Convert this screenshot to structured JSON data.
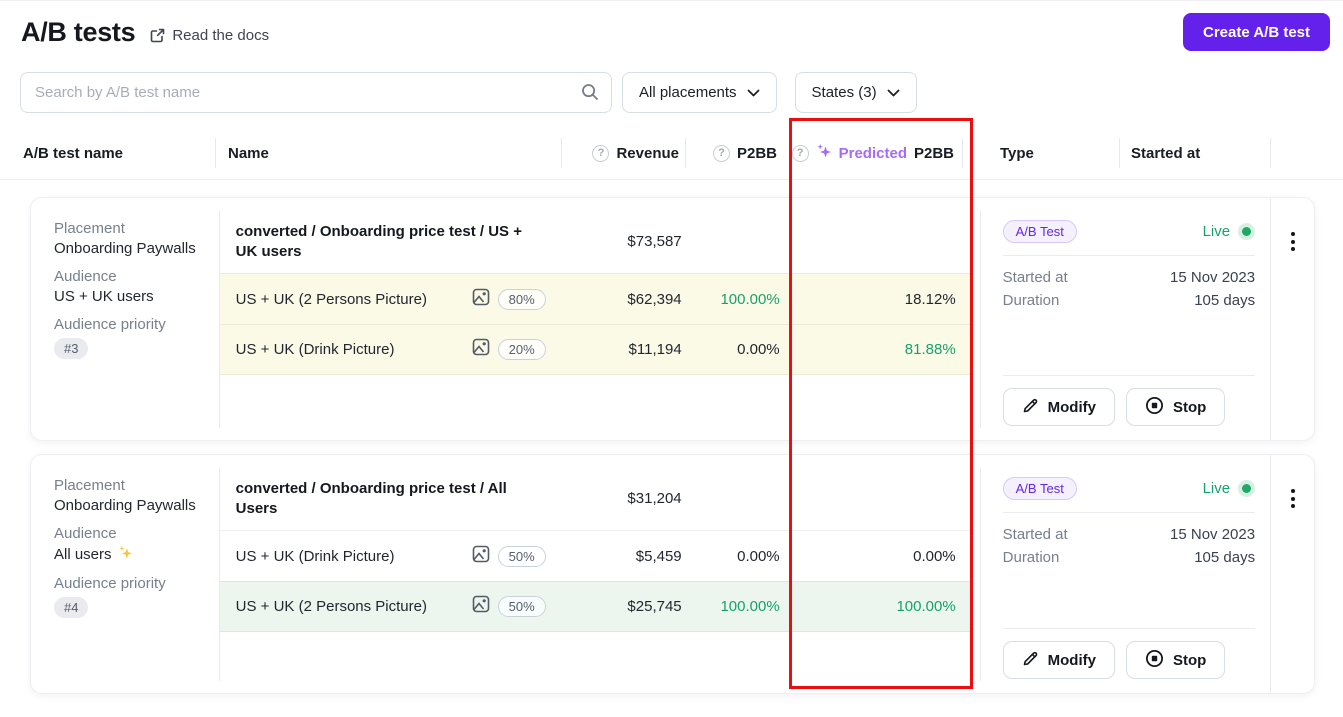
{
  "colors": {
    "accent_purple": "#6421EC",
    "predicted_purple": "#A66CF5",
    "success_green": "#17A16D",
    "row_highlight_yellow": "#FBFAE7",
    "row_highlight_green": "#ECF6EF",
    "highlight_box_red": "#EB0E0E"
  },
  "header": {
    "title": "A/B tests",
    "docs_link": "Read the docs",
    "create_button": "Create A/B test"
  },
  "filters": {
    "search_placeholder": "Search by A/B test name",
    "placements_dropdown": "All placements",
    "states_dropdown": "States (3)"
  },
  "table_headers": {
    "ab_test_name": "A/B test name",
    "name": "Name",
    "revenue": "Revenue",
    "p2bb": "P2BB",
    "predicted_label": "Predicted",
    "predicted_metric": "P2BB",
    "type": "Type",
    "started_at": "Started at"
  },
  "labels": {
    "placement": "Placement",
    "audience": "Audience",
    "audience_priority": "Audience priority",
    "started_at": "Started at",
    "duration": "Duration",
    "modify": "Modify",
    "stop": "Stop"
  },
  "tests": [
    {
      "placement": "Onboarding Paywalls",
      "audience": "US + UK users",
      "priority": "#3",
      "name": "converted / Onboarding price test / US + UK users",
      "revenue": "$73,587",
      "type_badge": "A/B Test",
      "status": "Live",
      "started_at": "15 Nov 2023",
      "duration": "105 days",
      "variants": [
        {
          "name": "US + UK (2 Persons Picture)",
          "weight": "80%",
          "revenue": "$62,394",
          "p2bb": "100.00%",
          "predicted_p2bb": "18.12%"
        },
        {
          "name": "US + UK (Drink Picture)",
          "weight": "20%",
          "revenue": "$11,194",
          "p2bb": "0.00%",
          "predicted_p2bb": "81.88%"
        }
      ]
    },
    {
      "placement": "Onboarding Paywalls",
      "audience": "All users",
      "priority": "#4",
      "name": "converted / Onboarding price test / All Users",
      "revenue": "$31,204",
      "type_badge": "A/B Test",
      "status": "Live",
      "started_at": "15 Nov 2023",
      "duration": "105 days",
      "variants": [
        {
          "name": "US + UK (Drink Picture)",
          "weight": "50%",
          "revenue": "$5,459",
          "p2bb": "0.00%",
          "predicted_p2bb": "0.00%"
        },
        {
          "name": "US + UK (2 Persons Picture)",
          "weight": "50%",
          "revenue": "$25,745",
          "p2bb": "100.00%",
          "predicted_p2bb": "100.00%"
        }
      ]
    }
  ]
}
